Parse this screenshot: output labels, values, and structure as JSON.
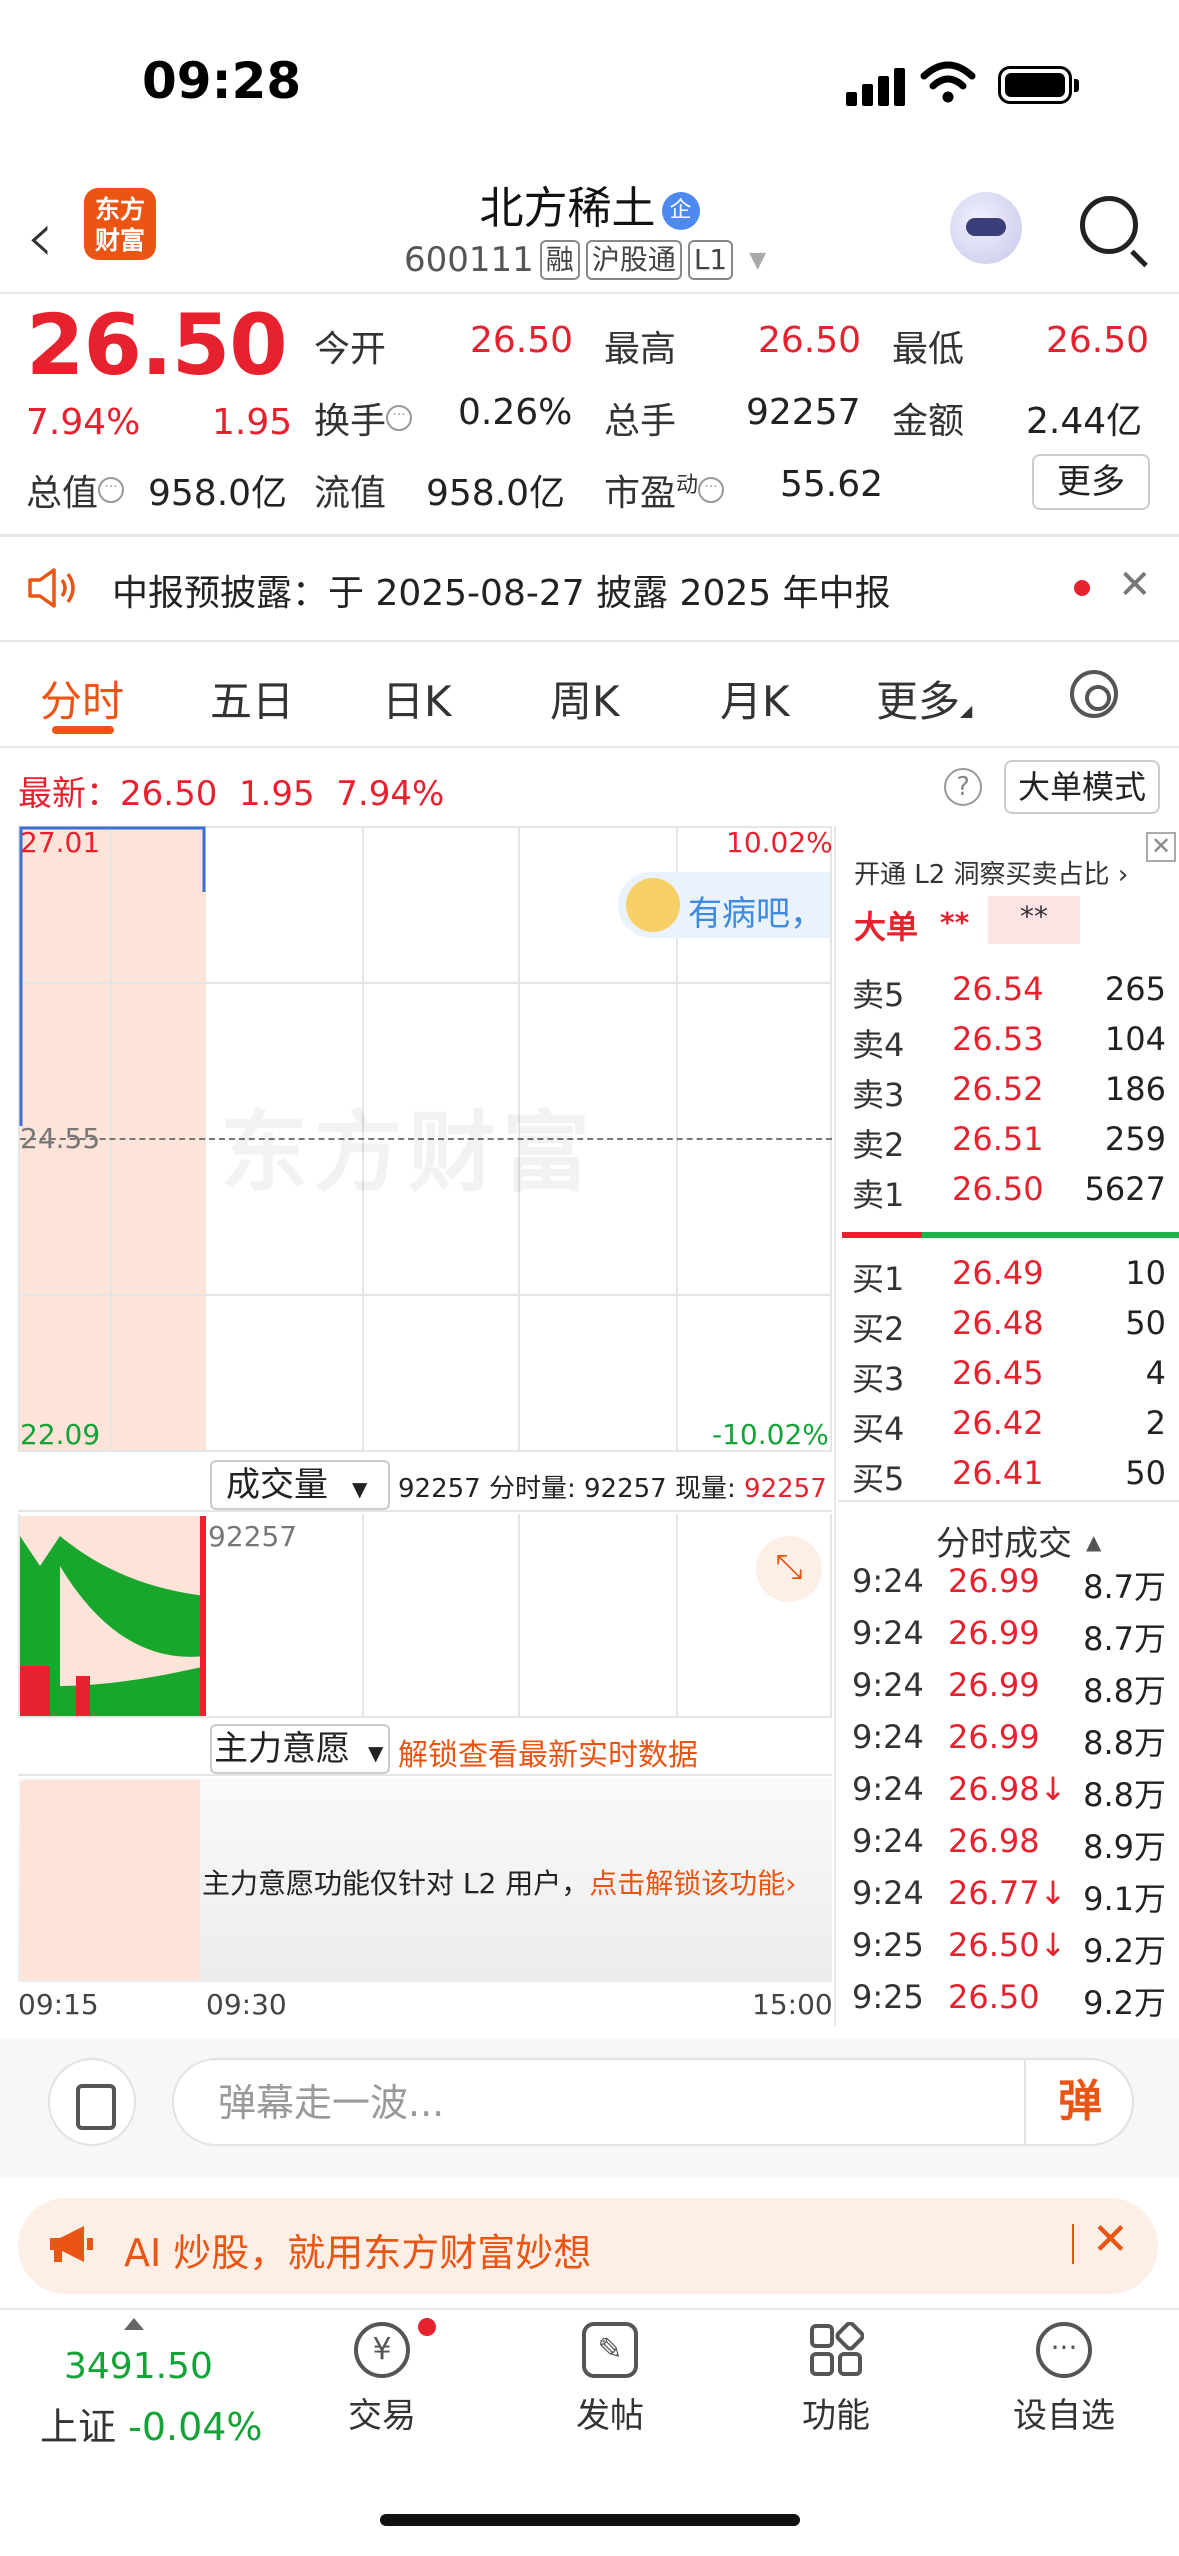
{
  "status": {
    "time": "09:28"
  },
  "header": {
    "logo_text": "东方财富",
    "stock_name": "北方稀土",
    "verified_badge": "企",
    "code": "600111",
    "tags": [
      "融",
      "沪股通",
      "L1"
    ]
  },
  "quote": {
    "price": "26.50",
    "change_pct": "7.94%",
    "change": "1.95",
    "open_label": "今开",
    "open": "26.50",
    "high_label": "最高",
    "high": "26.50",
    "low_label": "最低",
    "low": "26.50",
    "turnover_label": "换手",
    "turnover": "0.26%",
    "volume_label": "总手",
    "volume": "92257",
    "amount_label": "金额",
    "amount": "2.44亿",
    "mktcap_label": "总值",
    "mktcap": "958.0亿",
    "float_label": "流值",
    "float_cap": "958.0亿",
    "pe_label": "市盈",
    "pe_sup": "动",
    "pe": "55.62",
    "more_button": "更多"
  },
  "notice": {
    "text": "中报预披露：于 2025-08-27 披露 2025 年中报"
  },
  "tabs": [
    "分时",
    "五日",
    "日K",
    "周K",
    "月K",
    "更多"
  ],
  "latest_bar": {
    "label": "最新：",
    "price": "26.50",
    "change": "1.95",
    "pct": "7.94%",
    "help": "?",
    "big_order_mode": "大单模式"
  },
  "chart": {
    "y_top": "27.01",
    "y_mid": "24.55",
    "y_bottom": "22.09",
    "pct_top": "10.02%",
    "pct_bottom": "-10.02%",
    "watermark": "东方财富",
    "bubble_text": "有病吧，"
  },
  "orderbook": {
    "header": "开通 L2 洞察买卖占比 ›",
    "big_label": "大单",
    "big_val": "**",
    "big_box": "**",
    "asks": [
      {
        "label": "卖5",
        "price": "26.54",
        "vol": "265"
      },
      {
        "label": "卖4",
        "price": "26.53",
        "vol": "104"
      },
      {
        "label": "卖3",
        "price": "26.52",
        "vol": "186"
      },
      {
        "label": "卖2",
        "price": "26.51",
        "vol": "259"
      },
      {
        "label": "卖1",
        "price": "26.50",
        "vol": "5627"
      }
    ],
    "bids": [
      {
        "label": "买1",
        "price": "26.49",
        "vol": "10"
      },
      {
        "label": "买2",
        "price": "26.48",
        "vol": "50"
      },
      {
        "label": "买3",
        "price": "26.45",
        "vol": "4"
      },
      {
        "label": "买4",
        "price": "26.42",
        "vol": "2"
      },
      {
        "label": "买5",
        "price": "26.41",
        "vol": "50"
      }
    ]
  },
  "ticks": {
    "header": "分时成交",
    "rows": [
      {
        "t": "9:24",
        "p": "26.99",
        "v": "8.7万"
      },
      {
        "t": "9:24",
        "p": "26.99",
        "v": "8.7万"
      },
      {
        "t": "9:24",
        "p": "26.99",
        "v": "8.8万"
      },
      {
        "t": "9:24",
        "p": "26.99",
        "v": "8.8万"
      },
      {
        "t": "9:24",
        "p": "26.98↓",
        "v": "8.8万"
      },
      {
        "t": "9:24",
        "p": "26.98",
        "v": "8.9万"
      },
      {
        "t": "9:24",
        "p": "26.77↓",
        "v": "9.1万"
      },
      {
        "t": "9:25",
        "p": "26.50↓",
        "v": "9.2万"
      },
      {
        "t": "9:25",
        "p": "26.50",
        "v": "9.2万"
      }
    ]
  },
  "volume": {
    "select": "成交量",
    "info_total": "92257",
    "info_label1": "分时量:",
    "info_val1": "92257",
    "info_label2": "现量:",
    "info_val2": "92257",
    "axis_max": "92257"
  },
  "main_force": {
    "select": "主力意愿",
    "unlock_link": "解锁查看最新实时数据",
    "msg": "主力意愿功能仅针对 L2 用户，",
    "msg_link": "点击解锁该功能›"
  },
  "time_axis": [
    "09:15",
    "09:30",
    "15:00"
  ],
  "danmaku": {
    "placeholder": "弹幕走一波...",
    "button": "弹"
  },
  "ai_banner": {
    "text": "AI 炒股，就用东方财富妙想"
  },
  "bottom_nav": {
    "index_value": "3491.50",
    "index_name": "上证",
    "index_change": "-0.04%",
    "items": [
      "交易",
      "发帖",
      "功能",
      "设自选"
    ]
  },
  "colors": {
    "up": "#e8212e",
    "down": "#14a336",
    "accent": "#ea5513"
  }
}
